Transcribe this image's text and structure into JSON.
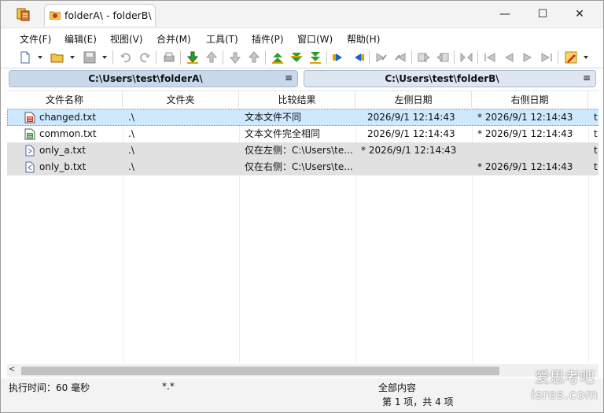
{
  "window": {
    "tab_title": "folderA\\ - folderB\\",
    "controls": {
      "minimize": "—",
      "maximize": "☐",
      "close": "✕"
    }
  },
  "menu": [
    "文件(F)",
    "编辑(E)",
    "视图(V)",
    "合并(M)",
    "工具(T)",
    "插件(P)",
    "窗口(W)",
    "帮助(H)"
  ],
  "paths": {
    "left": "C:\\Users\\test\\folderA\\",
    "right": "C:\\Users\\test\\folderB\\",
    "menu_glyph": "≡"
  },
  "table": {
    "columns": [
      "文件名称",
      "文件夹",
      "比较结果",
      "左侧日期",
      "右侧日期"
    ],
    "rows": [
      {
        "name": "changed.txt",
        "folder": ".\\",
        "result": "文本文件不同",
        "left_date": "2026/9/1 12:14:43",
        "right_date": "* 2026/9/1 12:14:43",
        "extra": "t",
        "icon": "file-different-icon"
      },
      {
        "name": "common.txt",
        "folder": ".\\",
        "result": "文本文件完全相同",
        "left_date": "2026/9/1 12:14:43",
        "right_date": "* 2026/9/1 12:14:43",
        "extra": "t",
        "icon": "file-identical-icon"
      },
      {
        "name": "only_a.txt",
        "folder": ".\\",
        "result": "仅在左侧：C:\\Users\\te...",
        "left_date": "* 2026/9/1 12:14:43",
        "right_date": "",
        "extra": "t",
        "icon": "file-left-only-icon"
      },
      {
        "name": "only_b.txt",
        "folder": ".\\",
        "result": "仅在右侧：C:\\Users\\te...",
        "left_date": "",
        "right_date": "* 2026/9/1 12:14:43",
        "extra": "t",
        "icon": "file-right-only-icon"
      }
    ]
  },
  "status": {
    "exec_time": "执行时间：60 毫秒",
    "filter": "*.*",
    "scope": "全部内容",
    "count": "第 1 项，共 4 项"
  },
  "watermark": {
    "line1": "爱思考吧",
    "line2": "isres.com"
  },
  "colors": {
    "selected_row": "#cde8ff",
    "unique_row": "#e1e1e1",
    "path_left": "#c9d9ec",
    "path_right": "#dde6f1"
  }
}
